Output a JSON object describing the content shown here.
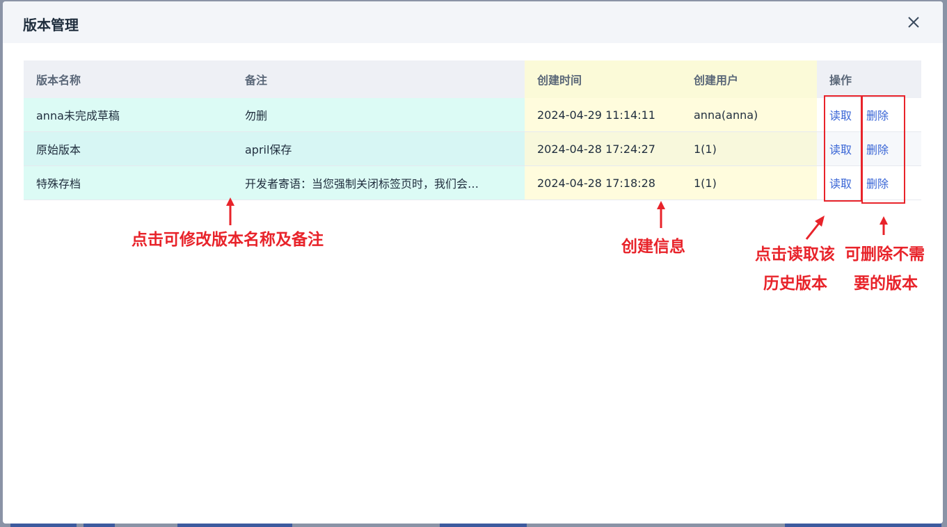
{
  "dialog": {
    "title": "版本管理",
    "close_icon": "close-icon"
  },
  "table": {
    "columns": [
      "版本名称",
      "备注",
      "创建时间",
      "创建用户",
      "操作"
    ],
    "rows": [
      {
        "name": "anna未完成草稿",
        "note": "勿删",
        "created_at": "2024-04-29 11:14:11",
        "user": "anna(anna)",
        "read": "读取",
        "delete": "删除"
      },
      {
        "name": "原始版本",
        "note": "april保存",
        "created_at": "2024-04-28 17:24:27",
        "user": "1(1)",
        "read": "读取",
        "delete": "删除"
      },
      {
        "name": "特殊存档",
        "note": "开发者寄语：当您强制关闭标签页时，我们会…",
        "created_at": "2024-04-28 17:18:28",
        "user": "1(1)",
        "read": "读取",
        "delete": "删除"
      }
    ]
  },
  "annotations": {
    "edit_hint": "点击可修改版本名称及备注",
    "create_info": "创建信息",
    "read_hint_line1": "点击读取该",
    "read_hint_line2": "历史版本",
    "delete_hint_line1": "可删除不需",
    "delete_hint_line2": "要的版本"
  },
  "colors": {
    "annotation_red": "#e8232a",
    "link_blue": "#3a66d6",
    "highlight_cyan": "#dcfbf5",
    "highlight_yellow": "#fffcdd"
  }
}
